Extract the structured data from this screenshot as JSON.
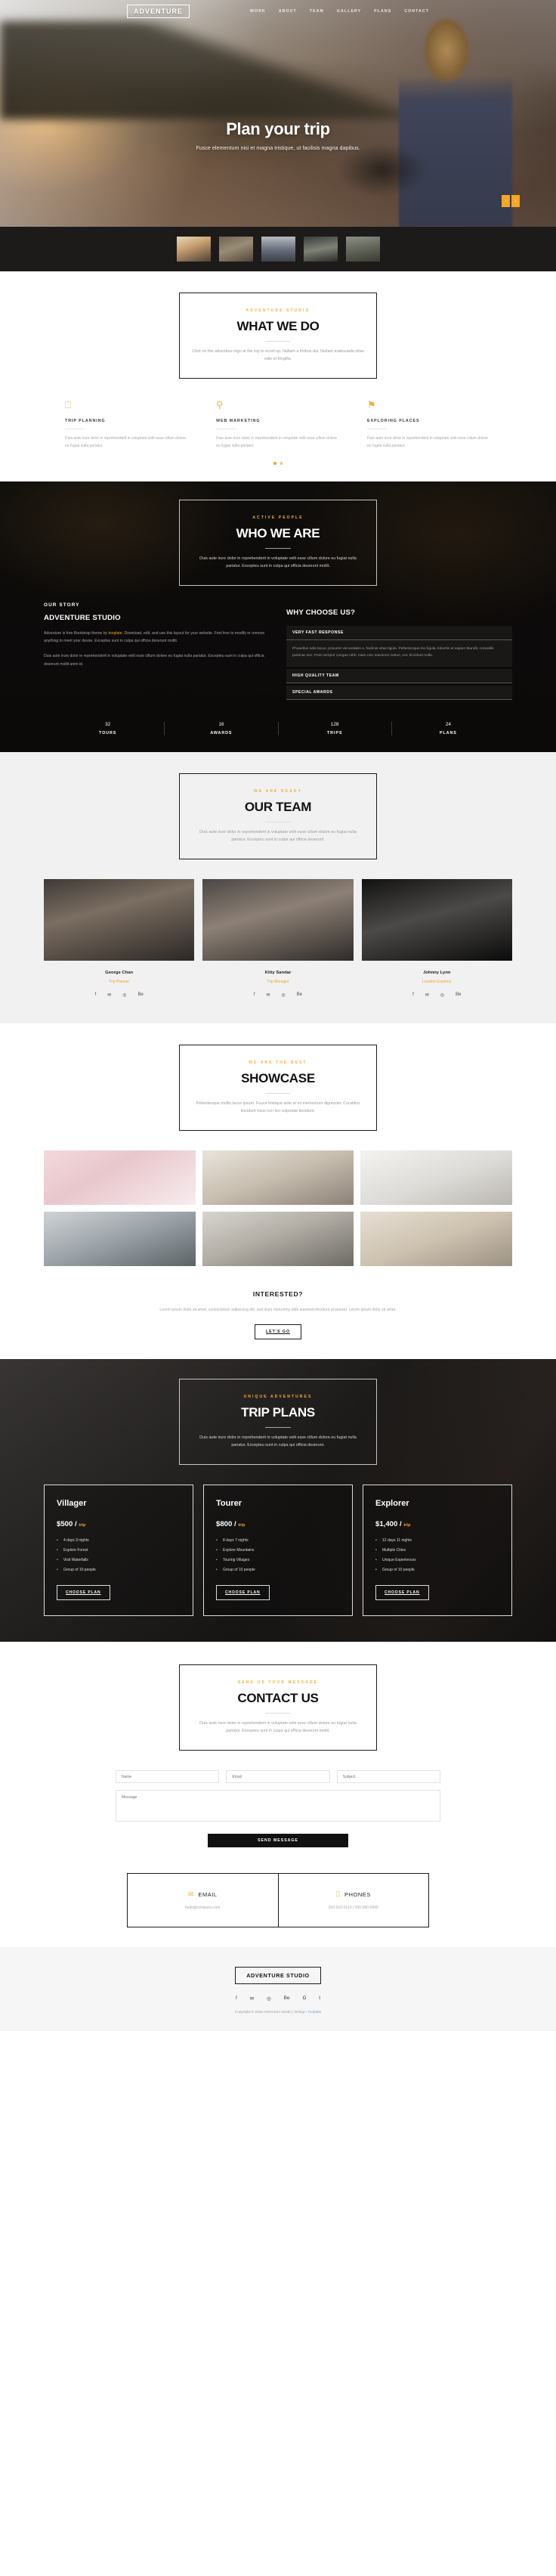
{
  "site": {
    "logo": "ADVENTURE",
    "footer_logo": "ADVENTURE STUDIO",
    "accent": "#f0a522",
    "dark": "#1d1b1a"
  },
  "nav": {
    "items": [
      {
        "label": "WORK"
      },
      {
        "label": "ABOUT"
      },
      {
        "label": "TEAM"
      },
      {
        "label": "GALLERY"
      },
      {
        "label": "PLANS"
      },
      {
        "label": "CONTACT"
      }
    ]
  },
  "hero": {
    "title": "Plan your trip",
    "subtitle": "Fusce elementum nisi et magna tristique, ut facilisis magna dapibus.",
    "prev_icon": "‹",
    "next_icon": "›",
    "thumbnails": [
      "thumb-1",
      "thumb-2",
      "thumb-3",
      "thumb-4",
      "thumb-5"
    ]
  },
  "what_we_do": {
    "eyebrow": "Adventure Studio",
    "title": "WHAT WE DO",
    "description": "Click on the adventure logo at the top to scroll up. Nullam a finibus dui. Nullam malesuada vitae odio et fringilla.",
    "services": [
      {
        "icon": "mobile-icon",
        "glyph": "⎕",
        "title": "TRIP PLANNING",
        "text": "Duis aute irure dolor in reprehenderit in voluptate velit esse cillum dolore eu fugiat nulla pariatur."
      },
      {
        "icon": "bicycle-icon",
        "glyph": "⚲",
        "title": "WEB MARKETING",
        "text": "Duis aute irure dolor in reprehenderit in voluptate velit esse cillum dolore eu fugiat nulla pariatur."
      },
      {
        "icon": "flag-icon",
        "glyph": "⚑",
        "title": "EXPLORING PLACES",
        "text": "Duis aute irure dolor in reprehenderit in voluptate velit esse cillum dolore eu fugiat nulla pariatur."
      }
    ]
  },
  "who_we_are": {
    "eyebrow": "ACTIVE PEOPLE",
    "title": "WHO WE ARE",
    "description": "Duis aute irure dolor in reprehenderit in voluptate velit esse cillum dolore eu fugiat nulla pariatur. Excepteu sunt in culpa qui officia deserunt mollit.",
    "story": {
      "kicker": "OUR STORY",
      "heading": "ADVENTURE STUDIO",
      "p1_before": "Adventure is free Bootstrap theme by ",
      "p1_link": "tooplate",
      "p1_after": ". Download, edit, and use this layout for your website. Feel free to modify or remove anything to meet your desire. Excepteu sunt in culpa qui officia deserunt mollit.",
      "p2": "Duis aute irure dolor in reprehenderit in voluptate velit esse cillum dolore eu fugiat nulla pariatur. Excepteu sunt in culpa qui officia deserunt mollit anim id."
    },
    "why": {
      "heading": "WHY CHOOSE US?",
      "items": [
        {
          "title": "VERY FAST RESPONSE",
          "body": "Phasellus odio lacus, posuere vel sodales a, facilisis vitae ligula. Pellentesque leo ligula, lobortis ut sapien blandit, convallis pulvinar nisi. Proin tempor congue nibh. Nam non maximus metus, nec tincidunt nulla.",
          "open": true
        },
        {
          "title": "HIGH QUALITY TEAM",
          "body": "",
          "open": false
        },
        {
          "title": "SPECIAL AWARDS",
          "body": "",
          "open": false
        }
      ]
    },
    "counters": [
      {
        "number": "32",
        "label": "TOURS"
      },
      {
        "number": "16",
        "label": "AWARDS"
      },
      {
        "number": "128",
        "label": "TRIPS"
      },
      {
        "number": "24",
        "label": "PLANS"
      }
    ]
  },
  "team": {
    "eyebrow": "WE ARE READY",
    "title": "OUR TEAM",
    "description": "Duis aute irure dolor in reprehenderit in voluptate velit esse cillum dolore eu fugiat nulla pariatur. Excepteu sunt in culpa qui officia deserunt.",
    "social_icons": [
      "facebook-icon",
      "twitter-icon",
      "instagram-icon",
      "behance-icon"
    ],
    "social_glyphs": [
      "f",
      "✉",
      "◎",
      "Be"
    ],
    "members": [
      {
        "name": "George Chan",
        "role": "Trip Planner"
      },
      {
        "name": "Kitty Sandar",
        "role": "Trip Manager"
      },
      {
        "name": "Johnny Lynn",
        "role": "Location Explorer"
      }
    ]
  },
  "showcase": {
    "eyebrow": "WE ARE THE BEST",
    "title": "SHOWCASE",
    "description": "Pellentesque mollis lacus ipsum. Fusce tristique ante et mi elementum dignissim. Curabitur tincidunt risus non leo vulputate tincidunt.",
    "images": [
      "gallery-1",
      "gallery-2",
      "gallery-3",
      "gallery-4",
      "gallery-5",
      "gallery-6"
    ],
    "interested": {
      "title": "INTERESTED?",
      "text": "Lorem ipsum dolor sit amet, consectetuer adipiscing elit, sed diam nonummy nibh euismod tincidunt ut laoreet. Lorem ipsum dolor sit amet.",
      "button": "LET'S GO"
    }
  },
  "plans": {
    "eyebrow": "UNIQUE ADVENTURES",
    "title": "TRIP PLANS",
    "description": "Duis aute irure dolor in reprehenderit in voluptate velit esse cillum dolore eu fugiat nulla pariatur. Excepteu sunt in culpa qui officia deserunt.",
    "items": [
      {
        "name": "Villager",
        "price": "$500 /",
        "per": "trip",
        "features": [
          "4 days 3 nights",
          "Explore Forest",
          "Visit Waterfalls",
          "Group of 10 people"
        ],
        "button": "CHOOSE PLAN"
      },
      {
        "name": "Tourer",
        "price": "$800 /",
        "per": "trip",
        "features": [
          "8 days 7 nights",
          "Explore Mountains",
          "Touring Villages",
          "Group of 10 people"
        ],
        "button": "CHOOSE PLAN"
      },
      {
        "name": "Explorer",
        "price": "$1,400 /",
        "per": "trip",
        "features": [
          "12 days 11 nights",
          "Multiple Cities",
          "Unique Experiences",
          "Group of 10 people"
        ],
        "button": "CHOOSE PLAN"
      }
    ]
  },
  "contact": {
    "eyebrow": "SEND US YOUR MESSAGE",
    "title": "CONTACT US",
    "description": "Duis aute irure dolor in reprehenderit in voluptate velit esse cillum dolore eu fugiat nulla pariatur. Excepteu sunt in culpa qui officia deserunt mollit.",
    "fields": {
      "name_placeholder": "Name",
      "email_placeholder": "Email",
      "subject_placeholder": "Subject",
      "message_placeholder": "Message"
    },
    "submit_label": "SEND MESSAGE",
    "boxes": [
      {
        "icon": "envelope-icon",
        "glyph": "✉",
        "title": "EMAIL",
        "value": "hello@company.com"
      },
      {
        "icon": "phone-icon",
        "glyph": "⎕",
        "title": "PHONES",
        "value": "010-010-0110 | 090-090-0990"
      }
    ]
  },
  "footer": {
    "social_icons": [
      "facebook-icon",
      "twitter-icon",
      "dribbble-icon",
      "behance-icon",
      "github-icon",
      "tumblr-icon"
    ],
    "social_glyphs": [
      "f",
      "✉",
      "◎",
      "Be",
      "Ω",
      "t"
    ],
    "copyright_before": "Copyright © 2016 Adventure Studio | Design: ",
    "copyright_link": "Tooplate"
  }
}
